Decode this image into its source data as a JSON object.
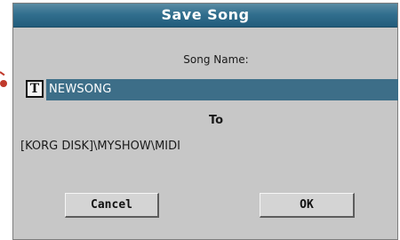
{
  "dialog": {
    "title": "Save Song",
    "song_name_label": "Song Name:",
    "song_name_value": "NEWSONG",
    "text_edit_icon_glyph": "T",
    "to_label": "To",
    "destination_path": "[KORG DISK]\\MYSHOW\\MIDI",
    "cancel_label": "Cancel",
    "ok_label": "OK"
  },
  "colors": {
    "title_bar": "#326f8e",
    "field_highlight": "#3d6e88",
    "dialog_background": "#c7c7c7",
    "callout": "#c0392b"
  },
  "icons": {
    "text_edit": "text-edit-icon",
    "callout": "callout-pointer-icon"
  }
}
